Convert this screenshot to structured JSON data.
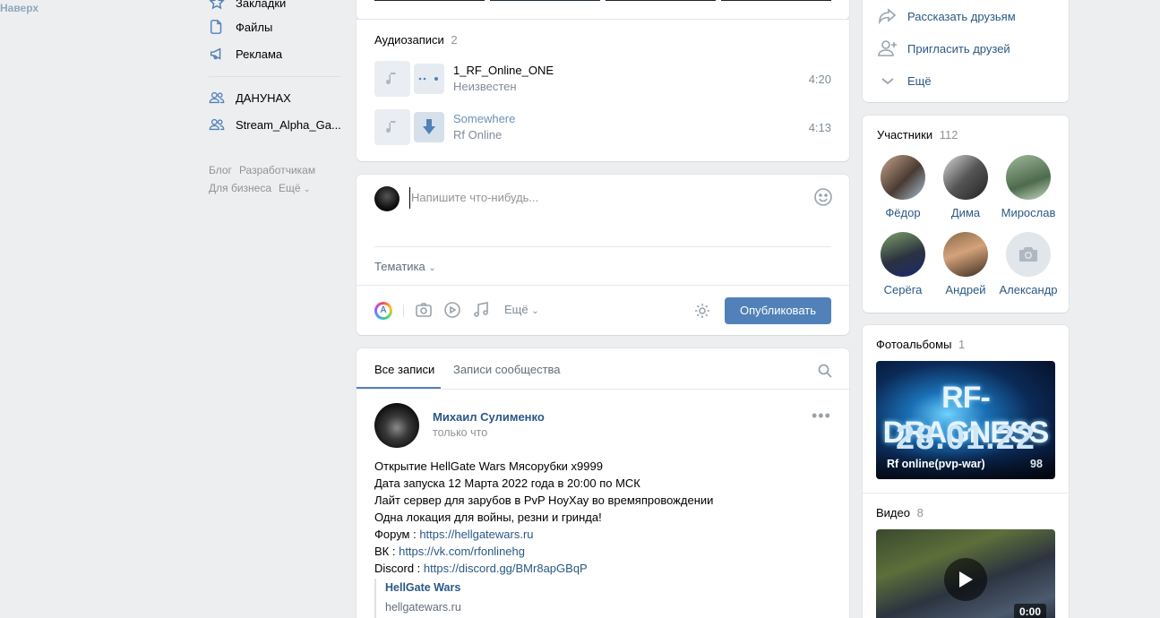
{
  "topbar": {
    "back_label": "Наверх"
  },
  "sidebar": {
    "items": [
      {
        "label": "Закладки",
        "icon": "star-icon"
      },
      {
        "label": "Файлы",
        "icon": "file-icon"
      },
      {
        "label": "Реклама",
        "icon": "megaphone-icon"
      }
    ],
    "groups": [
      {
        "label": "ДАНУНАХ",
        "icon": "users-icon"
      },
      {
        "label": "Stream_Alpha_Ga...",
        "icon": "users-icon"
      }
    ],
    "footer": {
      "blog": "Блог",
      "developers": "Разработчикам",
      "business": "Для бизнеса",
      "more": "Ещё"
    }
  },
  "audio": {
    "title": "Аудиозаписи",
    "count": "2",
    "tracks": [
      {
        "title": "1_RF_Online_ONE",
        "artist": "Неизвестен",
        "duration": "4:20"
      },
      {
        "title": "Somewhere",
        "artist": "Rf Online",
        "duration": "4:13"
      }
    ]
  },
  "composer": {
    "placeholder": "Напишите что-нибудь...",
    "topic_label": "Тематика",
    "more_label": "Ещё",
    "publish_label": "Опубликовать"
  },
  "feed": {
    "tabs": [
      {
        "label": "Все записи"
      },
      {
        "label": "Записи сообщества"
      }
    ],
    "post": {
      "author": "Михаил Сулименко",
      "time": "только что",
      "lines": [
        "Открытие HellGate Wars Мясорубки x9999",
        "Дата запуска 12 Марта 2022 года в 20:00 по МСК",
        "Лайт сервер для зарубов в PvP НоуХау во времяпровождении",
        "Одна локация для войны, резни и гринда!"
      ],
      "forum_prefix": "Форум : ",
      "forum_link": "https://hellgatewars.ru",
      "vk_prefix": "ВК : ",
      "vk_link": "https://vk.com/rfonlinehg",
      "discord_prefix": "Discord : ",
      "discord_link": "https://discord.gg/BMr8apGBqP",
      "snippet_title": "HellGate Wars",
      "snippet_domain": "hellgatewars.ru"
    }
  },
  "right": {
    "actions": [
      {
        "label": "Рассказать друзьям",
        "icon": "share-icon"
      },
      {
        "label": "Пригласить друзей",
        "icon": "add-user-icon"
      },
      {
        "label": "Ещё",
        "icon": "chevron-down-icon"
      }
    ],
    "members": {
      "title": "Участники",
      "count": "112",
      "people": [
        {
          "name": "Фёдор"
        },
        {
          "name": "Дима"
        },
        {
          "name": "Мирослав"
        },
        {
          "name": "Серёга"
        },
        {
          "name": "Андрей"
        },
        {
          "name": "Александр"
        }
      ]
    },
    "albums": {
      "title": "Фотоальбомы",
      "count": "1",
      "cover_line1": "RF-DRAGNESS",
      "cover_line2": "28.01.22",
      "album_name": "Rf online(pvp-war)",
      "album_count": "98"
    },
    "videos": {
      "title": "Видео",
      "count": "8",
      "duration": "0:00"
    }
  },
  "colors": {
    "accent": "#5181b8",
    "link": "#2a5885",
    "bg": "#edeef0"
  }
}
